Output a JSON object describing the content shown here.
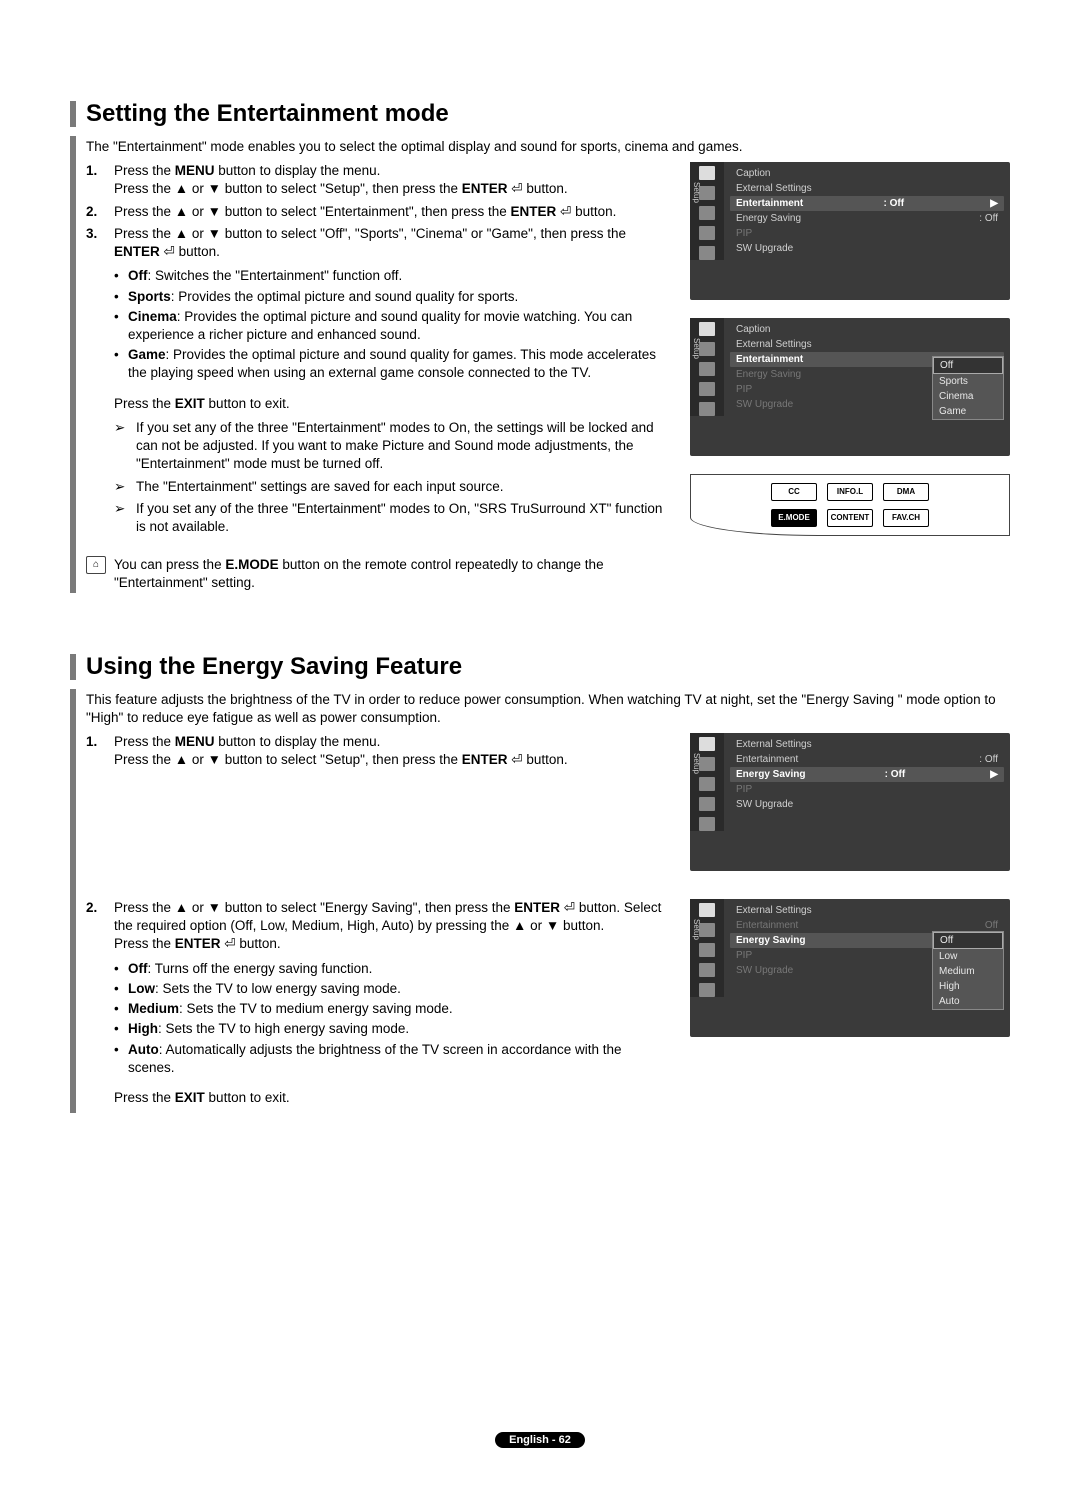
{
  "section1": {
    "title": "Setting the Entertainment mode",
    "intro": "The \"Entertainment\" mode enables you to select the optimal display and sound for sports, cinema and games.",
    "steps": {
      "s1a": "Press the ",
      "s1a_b": "MENU",
      "s1a2": " button to display the menu.",
      "s1b": "Press the ▲ or ▼ button to select \"Setup\", then press the ",
      "s1b_b": "ENTER",
      "s1b2": " ⏎ button.",
      "s2a": "Press the ▲ or ▼ button to select \"Entertainment\", then press the ",
      "s2a_b": "ENTER",
      "s2a2": " ⏎ button.",
      "s3a": "Press the ▲ or ▼ button to select \"Off\", \"Sports\", \"Cinema\" or \"Game\", then press the ",
      "s3a_b": "ENTER",
      "s3a2": " ⏎ button."
    },
    "bullets": {
      "b1_b": "Off",
      "b1": ": Switches the \"Entertainment\" function off.",
      "b2_b": "Sports",
      "b2": ": Provides the optimal picture and sound quality for sports.",
      "b3_b": "Cinema",
      "b3": ": Provides the optimal picture and sound quality for movie watching. You can experience a richer picture and enhanced sound.",
      "b4_b": "Game",
      "b4": ": Provides the optimal picture and sound quality for games. This mode accelerates the playing speed when using an external game console connected to the TV."
    },
    "exit_a": "Press the ",
    "exit_b": "EXIT",
    "exit_c": " button to exit.",
    "notes": {
      "n1": "If you set any of the three \"Entertainment\" modes to On, the settings will be locked and can not be adjusted. If you want to make Picture and Sound mode adjustments, the \"Entertainment\" mode must be turned off.",
      "n2": "The \"Entertainment\" settings are saved for each input source.",
      "n3": "If you set any of the three \"Entertainment\" modes to On, \"SRS TruSurround XT\" function is not available."
    },
    "remote_note_a": "You can press the ",
    "remote_note_b": "E.MODE",
    "remote_note_c": " button on the remote control repeatedly to change the \"Entertainment\" setting.",
    "osd1": {
      "setup": "Setup",
      "items": [
        {
          "label": "Caption",
          "val": ""
        },
        {
          "label": "External Settings",
          "val": ""
        },
        {
          "label": "Entertainment",
          "val": ": Off",
          "hl": true,
          "arrow": "▶"
        },
        {
          "label": "Energy Saving",
          "val": ": Off"
        },
        {
          "label": "PIP",
          "val": "",
          "dim": true
        },
        {
          "label": "SW Upgrade",
          "val": ""
        }
      ]
    },
    "osd2": {
      "setup": "Setup",
      "items": [
        {
          "label": "Caption",
          "val": ""
        },
        {
          "label": "External Settings",
          "val": ""
        },
        {
          "label": "Entertainment",
          "val": "",
          "hl": true
        },
        {
          "label": "Energy Saving",
          "val": "",
          "dim": true
        },
        {
          "label": "PIP",
          "val": "",
          "dim": true
        },
        {
          "label": "SW Upgrade",
          "val": "",
          "dim": true
        }
      ],
      "popup": [
        "Off",
        "Sports",
        "Cinema",
        "Game"
      ]
    },
    "remote": {
      "row1": [
        "CC",
        "INFO.L",
        "DMA"
      ],
      "row2": [
        "E.MODE",
        "CONTENT",
        "FAV.CH"
      ]
    }
  },
  "section2": {
    "title": "Using the Energy Saving Feature",
    "intro": "This feature adjusts the brightness of the TV in order to reduce power consumption. When watching TV at night, set the \"Energy Saving \" mode option to \"High\" to reduce eye fatigue as well as power consumption.",
    "steps": {
      "s1a": "Press the ",
      "s1a_b": "MENU",
      "s1a2": " button to display the menu.",
      "s1b": "Press the ▲ or ▼ button to select \"Setup\", then press the ",
      "s1b_b": "ENTER",
      "s1b2": " ⏎ button.",
      "s2a": "Press the ▲ or ▼ button to select \"Energy Saving\", then press the ",
      "s2a_b": "ENTER",
      "s2a2": " ⏎ button. Select the required option (Off, Low, Medium, High, Auto) by pressing the ▲ or ▼ button.",
      "s2c": "Press the ",
      "s2c_b": "ENTER",
      "s2c2": " ⏎ button."
    },
    "bullets": {
      "b1_b": "Off",
      "b1": ": Turns off the energy saving function.",
      "b2_b": "Low",
      "b2": ": Sets the TV to low energy saving mode.",
      "b3_b": "Medium",
      "b3": ": Sets the TV to medium energy saving mode.",
      "b4_b": "High",
      "b4": ": Sets the TV to high energy saving mode.",
      "b5_b": "Auto",
      "b5": ": Automatically adjusts the brightness of the TV screen in accordance with the scenes."
    },
    "exit_a": "Press the ",
    "exit_b": "EXIT",
    "exit_c": " button to exit.",
    "osd1": {
      "setup": "Setup",
      "items": [
        {
          "label": "External Settings",
          "val": ""
        },
        {
          "label": "Entertainment",
          "val": ": Off"
        },
        {
          "label": "Energy Saving",
          "val": ": Off",
          "hl": true,
          "arrow": "▶"
        },
        {
          "label": "PIP",
          "val": "",
          "dim": true
        },
        {
          "label": "SW Upgrade",
          "val": ""
        }
      ]
    },
    "osd2": {
      "setup": "Setup",
      "items": [
        {
          "label": "External Settings",
          "val": ""
        },
        {
          "label": "Entertainment",
          "val": "Off",
          "dim": true
        },
        {
          "label": "Energy Saving",
          "val": "",
          "hl": true
        },
        {
          "label": "PIP",
          "val": "",
          "dim": true
        },
        {
          "label": "SW Upgrade",
          "val": "",
          "dim": true
        }
      ],
      "popup": [
        "Off",
        "Low",
        "Medium",
        "High",
        "Auto"
      ]
    }
  },
  "footer": "English - 62"
}
